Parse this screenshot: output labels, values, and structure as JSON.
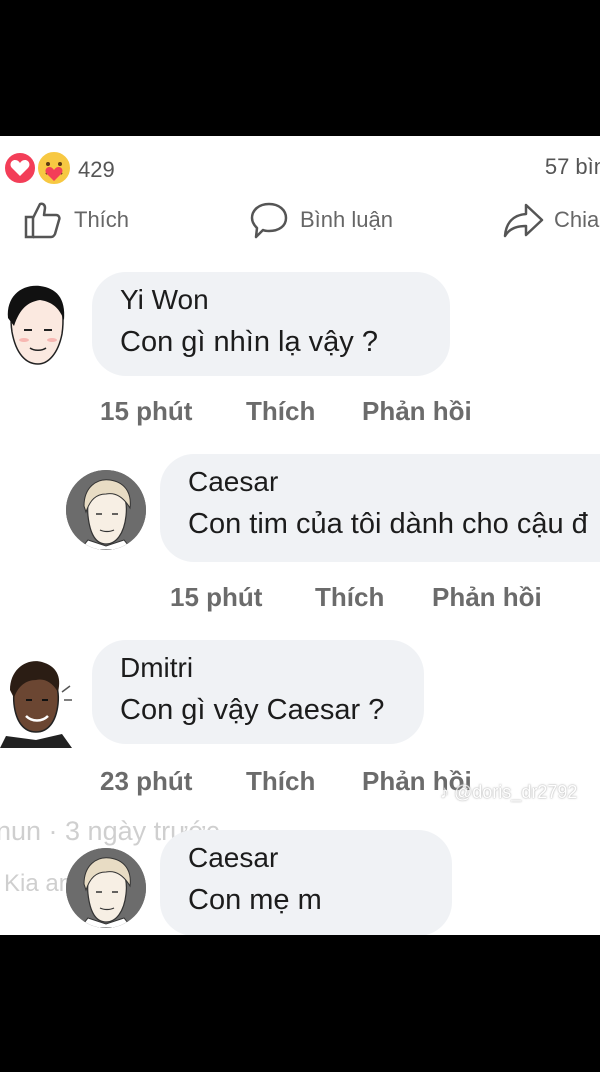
{
  "reactions": {
    "icons": [
      "love-reaction-icon",
      "care-reaction-icon"
    ],
    "count": "429",
    "share_text": "57 bìn"
  },
  "actions": {
    "like": "Thích",
    "comment": "Bình luận",
    "share": "Chia"
  },
  "comments": [
    {
      "name": "Yi Won",
      "text": "Con gì nhìn lạ vậy ?",
      "time": "15 phút",
      "like": "Thích",
      "reply": "Phản hồi"
    },
    {
      "name": "Caesar",
      "text": "Con tim của tôi dành cho cậu đ",
      "time": "15 phút",
      "like": "Thích",
      "reply": "Phản hồi"
    },
    {
      "name": "Dmitri",
      "text": "Con gì vậy Caesar ?",
      "time": "23 phút",
      "like": "Thích",
      "reply": "Phản hồi"
    },
    {
      "name": "Caesar",
      "text": "Con mẹ m"
    }
  ],
  "overlay": {
    "watermark": "@doris_dr2792",
    "ghost_line1": "nun · 3 ngày trước",
    "ghost_line2": "Kia anh"
  },
  "colors": {
    "background": "#ffffff",
    "bubble": "#f0f2f5",
    "meta_text": "#6b6b6b",
    "letterbox": "#000000"
  }
}
